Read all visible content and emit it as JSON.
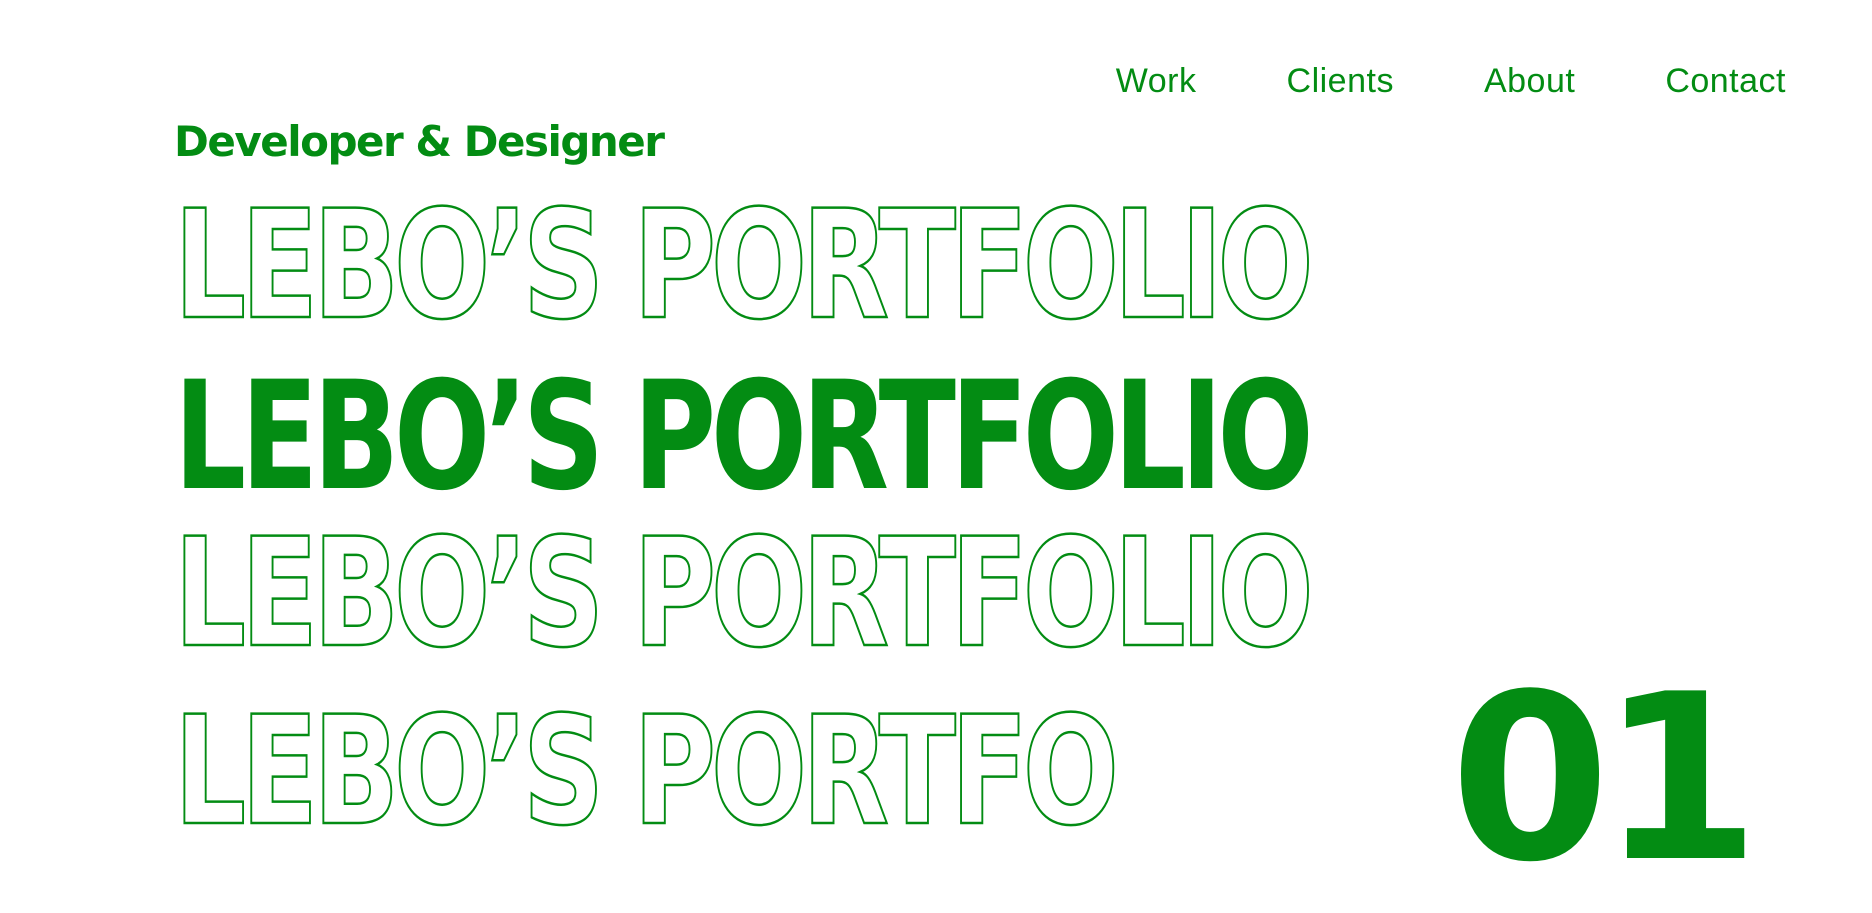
{
  "nav": {
    "items": [
      {
        "label": "Work"
      },
      {
        "label": "Clients"
      },
      {
        "label": "About"
      },
      {
        "label": "Contact"
      }
    ]
  },
  "hero": {
    "tagline": "Developer & Designer",
    "rows": [
      {
        "text": "LEBO’S PORTFOLIO",
        "style": "outline"
      },
      {
        "text": "LEBO’S PORTFOLIO",
        "style": "filled"
      },
      {
        "text": "LEBO’S PORTFOLIO",
        "style": "outline"
      },
      {
        "text": "LEBO’S PORTFO",
        "style": "outline"
      }
    ],
    "number": "01"
  },
  "colors": {
    "accent": "#038c13",
    "background": "#ffffff"
  }
}
